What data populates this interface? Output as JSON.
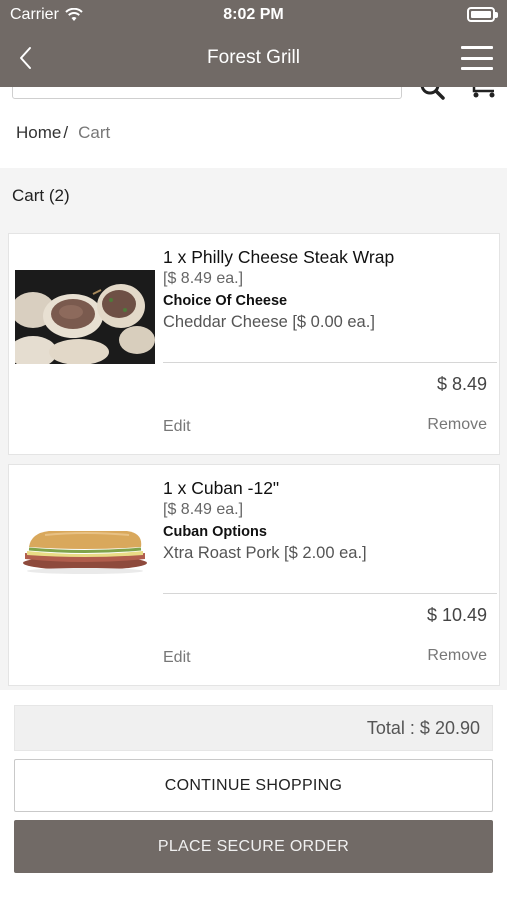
{
  "status_bar": {
    "carrier": "Carrier",
    "time": "8:02 PM"
  },
  "nav": {
    "title": "Forest Grill"
  },
  "breadcrumb": {
    "home": "Home",
    "separator": "/",
    "current": "Cart"
  },
  "cart": {
    "header": "Cart (2)",
    "items": [
      {
        "name": "1 x Philly Cheese Steak Wrap",
        "unit_price": "[$ 8.49 ea.]",
        "option_label": "Choice Of Cheese",
        "option_value": "Cheddar Cheese [$ 0.00 ea.]",
        "price": "$ 8.49",
        "edit_label": "Edit",
        "remove_label": "Remove"
      },
      {
        "name": "1 x Cuban -12\"",
        "unit_price": "[$ 8.49 ea.]",
        "option_label": "Cuban Options",
        "option_value": "Xtra Roast Pork [$ 2.00 ea.]",
        "price": "$ 10.49",
        "edit_label": "Edit",
        "remove_label": "Remove"
      }
    ]
  },
  "footer": {
    "total": "Total : $ 20.90",
    "continue_label": "CONTINUE SHOPPING",
    "place_order_label": "PLACE SECURE ORDER"
  },
  "colors": {
    "brand_bar": "#716a66",
    "background": "#f4f4f4"
  }
}
